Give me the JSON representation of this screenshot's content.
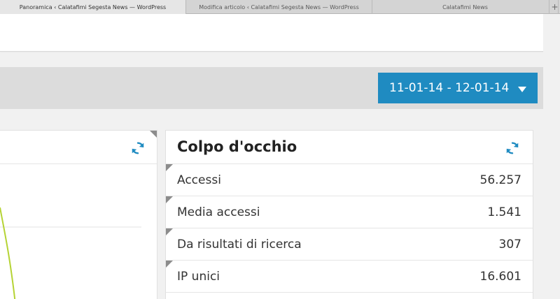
{
  "browser": {
    "tabs": [
      {
        "label": "Panoramica ‹ Calatafimi Segesta News — WordPress",
        "active": true
      },
      {
        "label": "Modifica articolo ‹ Calatafimi Segesta News — WordPress",
        "active": false
      },
      {
        "label": "Calatafimi News",
        "active": false
      }
    ],
    "new_tab_label": "+"
  },
  "date_range": {
    "label": "11-01-14 - 12-01-14",
    "color": "#1f8bc1"
  },
  "left_widget": {
    "refresh_icon": "refresh-icon",
    "line_color": "#b5d334"
  },
  "at_a_glance": {
    "title": "Colpo d'occhio",
    "refresh_icon": "refresh-icon",
    "rows": [
      {
        "label": "Accessi",
        "value": "56.257"
      },
      {
        "label": "Media accessi",
        "value": "1.541"
      },
      {
        "label": "Da risultati di ricerca",
        "value": "307"
      },
      {
        "label": "IP unici",
        "value": "16.601"
      }
    ]
  },
  "colors": {
    "accent": "#1f8bc1",
    "refresh": "#1f8bc1"
  }
}
